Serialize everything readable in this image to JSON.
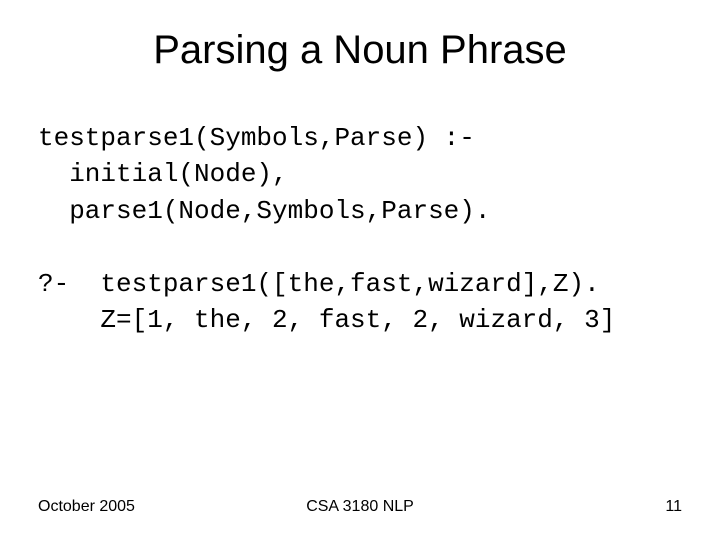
{
  "title": "Parsing a Noun Phrase",
  "code": {
    "l1": "testparse1(Symbols,Parse) :-",
    "l2": "  initial(Node),",
    "l3": "  parse1(Node,Symbols,Parse).",
    "l4": "",
    "l5": "?-  testparse1([the,fast,wizard],Z).",
    "l6": "    Z=[1, the, 2, fast, 2, wizard, 3]"
  },
  "footer": {
    "left": "October 2005",
    "center": "CSA 3180 NLP",
    "right": "11"
  }
}
